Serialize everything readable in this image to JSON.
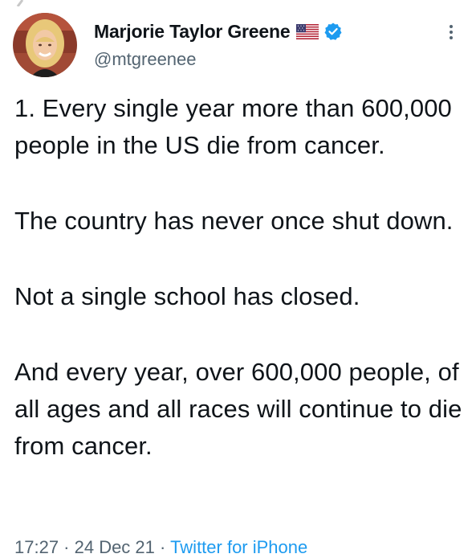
{
  "author": {
    "display_name": "Marjorie Taylor Greene",
    "handle": "@mtgreenee",
    "flag_icon": "us-flag-icon",
    "verified_icon": "verified-badge-icon",
    "verified_color": "#1d9bf0"
  },
  "tweet": {
    "paragraphs": [
      "1. Every single year more than 600,000 people in the US die from cancer.",
      "The country has never once shut down.",
      "Not a single school has closed.",
      "And every year, over 600,000 people, of all ages and all races will continue to die from cancer."
    ],
    "timestamp": "17:27 · 24 Dec 21",
    "separator": " · ",
    "source": "Twitter for iPhone"
  },
  "actions": {
    "more_icon": "more-options-icon"
  }
}
